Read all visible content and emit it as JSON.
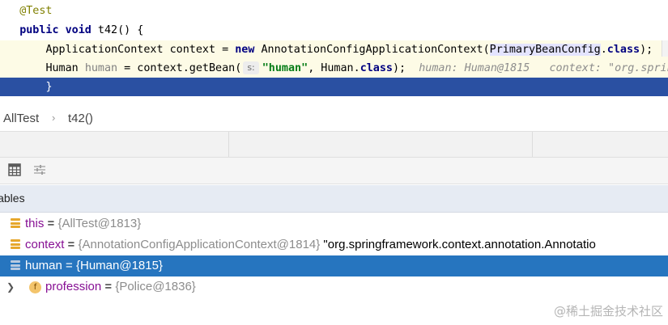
{
  "editor": {
    "line1": {
      "annotation": "@Test"
    },
    "line2": {
      "kw_public": "public",
      "kw_void": "void",
      "rest": " t42() {"
    },
    "line3": {
      "part1": "ApplicationContext context = ",
      "kw_new": "new",
      "part2": " AnnotationConfigApplicationContext(",
      "highlight": "PrimaryBeanConfig",
      "part3": ".",
      "kw_class": "class",
      "part4": ");"
    },
    "line4": {
      "part1": "Human ",
      "unused": "human",
      "part2": " = context.getBean(",
      "hint": "s:",
      "str": "\"human\"",
      "part3": ", Human.",
      "kw_class": "class",
      "part4": ");",
      "inline_debug": "human: Human@1815   context: \"org.sprin"
    },
    "line5": {
      "brace": "}"
    }
  },
  "breadcrumb": {
    "class_name": "AllTest",
    "separator": "›",
    "method": "t42()"
  },
  "toolbar": {
    "icons": [
      "table-icon",
      "settings-sliders-icon"
    ]
  },
  "variables": {
    "title": "iables",
    "rows": [
      {
        "name": "this",
        "eq": " = ",
        "value": "{AllTest@1813}",
        "extra": ""
      },
      {
        "name": "context",
        "eq": " = ",
        "value": "{AnnotationConfigApplicationContext@1814}",
        "extra": " \"org.springframework.context.annotation.Annotatio"
      },
      {
        "name": "human",
        "eq": " = ",
        "value": "{Human@1815}",
        "extra": ""
      },
      {
        "field_badge": "f",
        "name": "profession",
        "eq": " = ",
        "value": "{Police@1836}",
        "extra": ""
      }
    ]
  },
  "watermark": "@稀土掘金技术社区",
  "colors": {
    "selection": "#2675bf",
    "current_line": "#2a50a2",
    "string": "#067d17",
    "keyword": "#000080"
  }
}
